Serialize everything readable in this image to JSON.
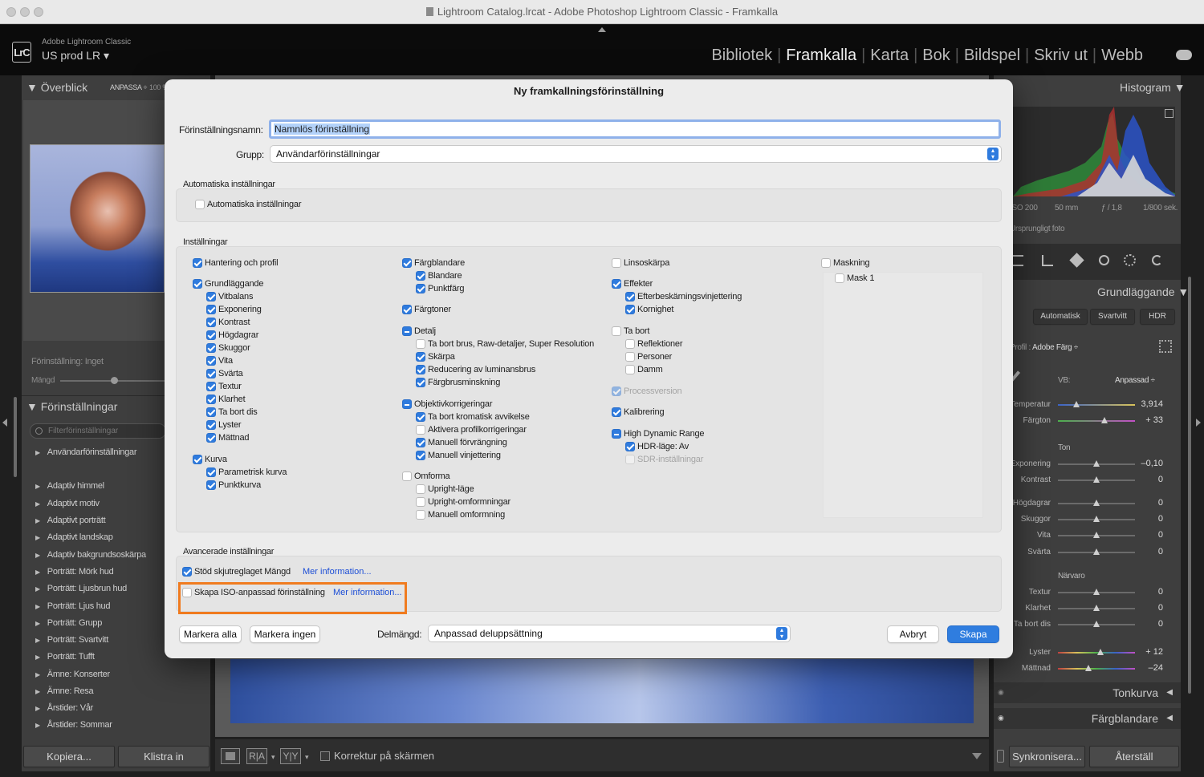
{
  "window": {
    "title": "Lightroom Catalog.lrcat - Adobe Photoshop Lightroom Classic - Framkalla"
  },
  "identity": {
    "logo": "LrC",
    "product": "Adobe Lightroom Classic",
    "catalog": "US prod LR"
  },
  "modules": [
    "Bibliotek",
    "Framkalla",
    "Karta",
    "Bok",
    "Bildspel",
    "Skriv ut",
    "Webb"
  ],
  "left_panel": {
    "navigator": {
      "title": "Överblick",
      "fit": "ANPASSA",
      "zoom": "100 %"
    },
    "preset_info": "Förinställning: Inget",
    "amount_label": "Mängd",
    "presets_title": "Förinställningar",
    "filter_placeholder": "Filterförinställningar",
    "groups": [
      "Användarförinställningar",
      "Adaptiv himmel",
      "Adaptivt motiv",
      "Adaptivt porträtt",
      "Adaptivt landskap",
      "Adaptiv bakgrundsoskärpa",
      "Porträtt: Mörk hud",
      "Porträtt: Ljusbrun hud",
      "Porträtt: Ljus hud",
      "Porträtt: Grupp",
      "Porträtt: Svartvitt",
      "Porträtt: Tufft",
      "Ämne: Konserter",
      "Ämne: Resa",
      "Årstider: Vår",
      "Årstider: Sommar"
    ],
    "copy_button": "Kopiera...",
    "paste_button": "Klistra in"
  },
  "right_panel": {
    "histogram_title": "Histogram",
    "exif": {
      "iso": "ISO 200",
      "focal": "50 mm",
      "aperture": "ƒ / 1,8",
      "shutter": "1/800 sek."
    },
    "original_photo": "Ursprungligt foto",
    "basic_title": "Grundläggande",
    "treatment": [
      "Automatisk",
      "Svartvitt",
      "HDR"
    ],
    "profile_label": "Profil :",
    "profile_value": "Adobe Färg",
    "wb_label": "VB:",
    "wb_value": "Anpassad",
    "temp": {
      "label": "Temperatur",
      "value": "3,914"
    },
    "tint": {
      "label": "Färgton",
      "value": "+ 33"
    },
    "tone_title": "Ton",
    "tone": [
      {
        "label": "Exponering",
        "value": "–0,10"
      },
      {
        "label": "Kontrast",
        "value": "0"
      }
    ],
    "tone2": [
      {
        "label": "Högdagrar",
        "value": "0"
      },
      {
        "label": "Skuggor",
        "value": "0"
      },
      {
        "label": "Vita",
        "value": "0"
      },
      {
        "label": "Svärta",
        "value": "0"
      }
    ],
    "presence_title": "Närvaro",
    "presence": [
      {
        "label": "Textur",
        "value": "0"
      },
      {
        "label": "Klarhet",
        "value": "0"
      },
      {
        "label": "Ta bort dis",
        "value": "0"
      }
    ],
    "vibrance": {
      "label": "Lyster",
      "value": "+ 12"
    },
    "saturation": {
      "label": "Mättnad",
      "value": "–24"
    },
    "tone_curve": "Tonkurva",
    "mixer": "Färgblandare",
    "sync_button": "Synkronisera...",
    "reset_button": "Återställ"
  },
  "toolbar": {
    "before_after": "R|A",
    "yy": "Y|Y",
    "proof": "Korrektur på skärmen"
  },
  "dialog": {
    "title": "Ny framkallningsförinställning",
    "name_label": "Förinställningsnamn:",
    "name_value": "Namnlös förinställning",
    "group_label": "Grupp:",
    "group_value": "Användarförinställningar",
    "auto_section": "Automatiska inställningar",
    "auto_checkbox": "Automatiska inställningar",
    "settings_section": "Inställningar",
    "col1": [
      {
        "label": "Hantering och profil",
        "state": "on",
        "level": 0
      },
      {
        "label": "Grundläggande",
        "state": "on",
        "level": 0
      },
      {
        "label": "Vitbalans",
        "state": "on",
        "level": 1
      },
      {
        "label": "Exponering",
        "state": "on",
        "level": 1
      },
      {
        "label": "Kontrast",
        "state": "on",
        "level": 1
      },
      {
        "label": "Högdagrar",
        "state": "on",
        "level": 1
      },
      {
        "label": "Skuggor",
        "state": "on",
        "level": 1
      },
      {
        "label": "Vita",
        "state": "on",
        "level": 1
      },
      {
        "label": "Svärta",
        "state": "on",
        "level": 1
      },
      {
        "label": "Textur",
        "state": "on",
        "level": 1
      },
      {
        "label": "Klarhet",
        "state": "on",
        "level": 1
      },
      {
        "label": "Ta bort dis",
        "state": "on",
        "level": 1
      },
      {
        "label": "Lyster",
        "state": "on",
        "level": 1
      },
      {
        "label": "Mättnad",
        "state": "on",
        "level": 1
      },
      {
        "label": "Kurva",
        "state": "on",
        "level": 0
      },
      {
        "label": "Parametrisk kurva",
        "state": "on",
        "level": 1
      },
      {
        "label": "Punktkurva",
        "state": "on",
        "level": 1
      }
    ],
    "col2": [
      {
        "label": "Färgblandare",
        "state": "on",
        "level": 0
      },
      {
        "label": "Blandare",
        "state": "on",
        "level": 1
      },
      {
        "label": "Punktfärg",
        "state": "on",
        "level": 1
      },
      {
        "label": "Färgtoner",
        "state": "on",
        "level": 0
      },
      {
        "label": "Detalj",
        "state": "mix",
        "level": 0
      },
      {
        "label": "Ta bort brus, Raw-detaljer, Super Resolution",
        "state": "off",
        "level": 1
      },
      {
        "label": "Skärpa",
        "state": "on",
        "level": 1
      },
      {
        "label": "Reducering av luminansbrus",
        "state": "on",
        "level": 1
      },
      {
        "label": "Färgbrusminskning",
        "state": "on",
        "level": 1
      },
      {
        "label": "Objektivkorrigeringar",
        "state": "mix",
        "level": 0
      },
      {
        "label": "Ta bort kromatisk avvikelse",
        "state": "on",
        "level": 1
      },
      {
        "label": "Aktivera profilkorrigeringar",
        "state": "off",
        "level": 1
      },
      {
        "label": "Manuell förvrängning",
        "state": "on",
        "level": 1
      },
      {
        "label": "Manuell vinjettering",
        "state": "on",
        "level": 1
      },
      {
        "label": "Omforma",
        "state": "off",
        "level": 0
      },
      {
        "label": "Upright-läge",
        "state": "off",
        "level": 1
      },
      {
        "label": "Upright-omformningar",
        "state": "off",
        "level": 1
      },
      {
        "label": "Manuell omformning",
        "state": "off",
        "level": 1
      }
    ],
    "col3": [
      {
        "label": "Linsoskärpa",
        "state": "off",
        "level": 0
      },
      {
        "label": "Effekter",
        "state": "on",
        "level": 0
      },
      {
        "label": "Efterbeskärningsvinjettering",
        "state": "on",
        "level": 1
      },
      {
        "label": "Kornighet",
        "state": "on",
        "level": 1
      },
      {
        "label": "Ta bort",
        "state": "off",
        "level": 0
      },
      {
        "label": "Reflektioner",
        "state": "off",
        "level": 1
      },
      {
        "label": "Personer",
        "state": "off",
        "level": 1
      },
      {
        "label": "Damm",
        "state": "off",
        "level": 1
      },
      {
        "label": "Processversion",
        "state": "dis",
        "level": 0
      },
      {
        "label": "Kalibrering",
        "state": "on",
        "level": 0
      },
      {
        "label": "High Dynamic Range",
        "state": "mix",
        "level": 0
      },
      {
        "label": "HDR-läge: Av",
        "state": "on",
        "level": 1
      },
      {
        "label": "SDR-inställningar",
        "state": "disoff",
        "level": 1
      }
    ],
    "col4": [
      {
        "label": "Maskning",
        "state": "off",
        "level": 0
      },
      {
        "label": "Mask 1",
        "state": "off",
        "level": 1
      }
    ],
    "advanced_section": "Avancerade inställningar",
    "support_amount": "Stöd skjutreglaget Mängd",
    "iso_adaptive": "Skapa ISO-anpassad förinställning",
    "more_info": "Mer information...",
    "check_all": "Markera alla",
    "check_none": "Markera ingen",
    "subset_label": "Delmängd:",
    "subset_value": "Anpassad deluppsättning",
    "cancel": "Avbryt",
    "create": "Skapa"
  },
  "colors": {
    "accent": "#2f7bde",
    "highlight": "#f07b1f",
    "link": "#1c4ed6"
  }
}
